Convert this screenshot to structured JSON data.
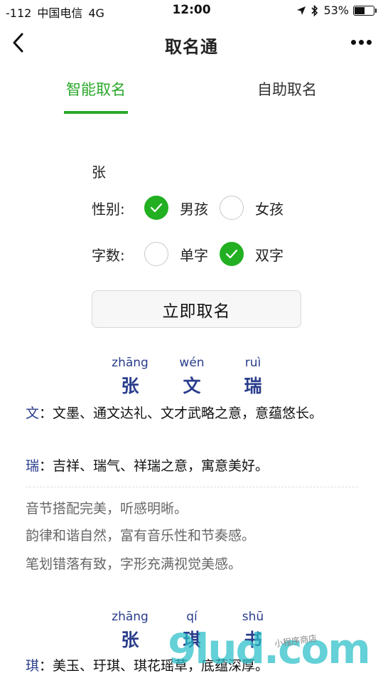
{
  "status": {
    "signal": "-112",
    "carrier": "中国电信",
    "network": "4G",
    "time": "12:00",
    "battery": "53%",
    "battery_level": 0.53
  },
  "nav": {
    "title": "取名通",
    "back_icon": "chevron-left-icon",
    "more_icon": "more-dots-icon"
  },
  "tabs": [
    {
      "label": "智能取名",
      "active": true
    },
    {
      "label": "自助取名",
      "active": false
    }
  ],
  "form": {
    "surname": "张",
    "gender_label": "性别:",
    "gender_options": [
      {
        "label": "男孩",
        "checked": true
      },
      {
        "label": "女孩",
        "checked": false
      }
    ],
    "count_label": "字数:",
    "count_options": [
      {
        "label": "单字",
        "checked": false
      },
      {
        "label": "双字",
        "checked": true
      }
    ],
    "button_label": "立即取名"
  },
  "results": [
    {
      "chars": [
        {
          "pinyin": "zhāng",
          "char": "张"
        },
        {
          "pinyin": "wén",
          "char": "文"
        },
        {
          "pinyin": "ruì",
          "char": "瑞"
        }
      ],
      "meanings": [
        {
          "char": "文",
          "text": "：文墨、通文达礼、文才武略之意，意蕴悠长。"
        },
        {
          "char": "瑞",
          "text": "：吉祥、瑞气、祥瑞之意，寓意美好。"
        }
      ],
      "comments": [
        "音节搭配完美，听感明晰。",
        "韵律和谐自然，富有音乐性和节奏感。",
        "笔划错落有致，字形充满视觉美感。"
      ]
    },
    {
      "chars": [
        {
          "pinyin": "zhāng",
          "char": "张"
        },
        {
          "pinyin": "qí",
          "char": "琪"
        },
        {
          "pinyin": "shū",
          "char": "书"
        }
      ],
      "meanings": [
        {
          "char": "琪",
          "text": "：美玉、玗琪、琪花瑶草，底蕴深厚。"
        }
      ]
    }
  ],
  "watermark": {
    "text": "9lud.com",
    "cn": "小程序商店"
  },
  "colors": {
    "accent": "#2aa82a",
    "radio_checked": "#22b022",
    "name_blue": "#2a3d8c"
  }
}
